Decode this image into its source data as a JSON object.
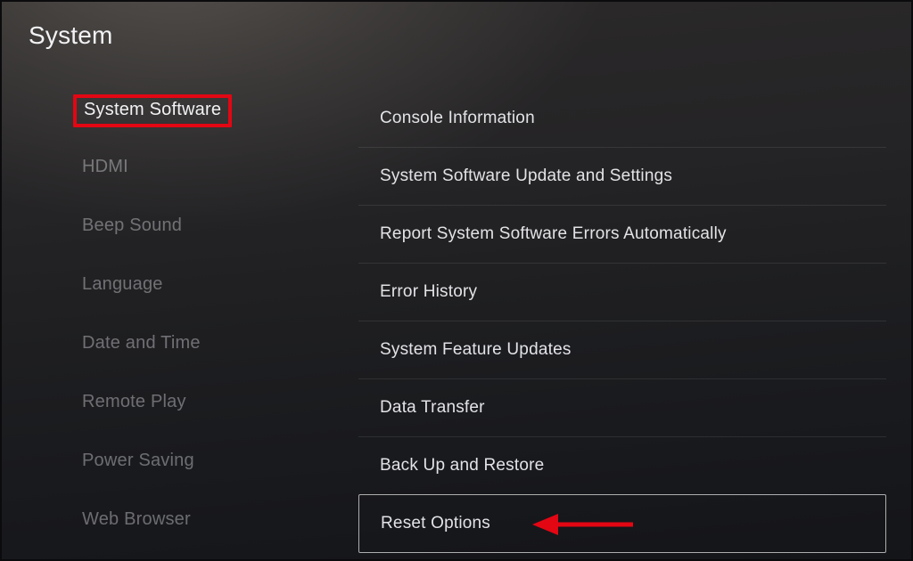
{
  "page_title": "System",
  "sidebar": {
    "items": [
      {
        "label": "System Software",
        "active": true,
        "highlighted": true
      },
      {
        "label": "HDMI",
        "active": false,
        "highlighted": false
      },
      {
        "label": "Beep Sound",
        "active": false,
        "highlighted": false
      },
      {
        "label": "Language",
        "active": false,
        "highlighted": false
      },
      {
        "label": "Date and Time",
        "active": false,
        "highlighted": false
      },
      {
        "label": "Remote Play",
        "active": false,
        "highlighted": false
      },
      {
        "label": "Power Saving",
        "active": false,
        "highlighted": false
      },
      {
        "label": "Web Browser",
        "active": false,
        "highlighted": false
      }
    ]
  },
  "options": [
    {
      "label": "Console Information",
      "focused": false
    },
    {
      "label": "System Software Update and Settings",
      "focused": false
    },
    {
      "label": "Report System Software Errors Automatically",
      "focused": false
    },
    {
      "label": "Error History",
      "focused": false
    },
    {
      "label": "System Feature Updates",
      "focused": false
    },
    {
      "label": "Data Transfer",
      "focused": false
    },
    {
      "label": "Back Up and Restore",
      "focused": false
    },
    {
      "label": "Reset Options",
      "focused": true
    }
  ],
  "annotation": {
    "arrow_color": "#e30613",
    "highlight_color": "#e30613"
  }
}
